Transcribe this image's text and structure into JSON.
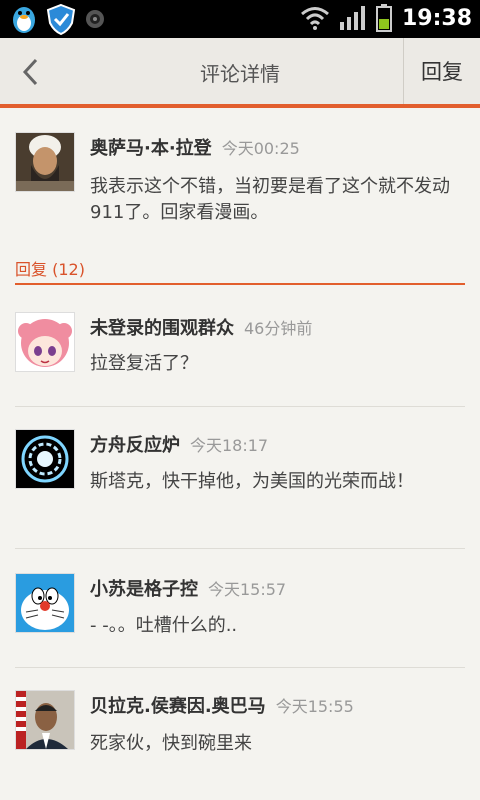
{
  "status_bar": {
    "time": "19:38"
  },
  "header": {
    "title": "评论详情",
    "reply_label": "回复"
  },
  "post": {
    "author": "奥萨马·本·拉登",
    "time": "今天00:25",
    "content": "我表示这个不错，当初要是看了这个就不发动911了。回家看漫画。"
  },
  "replies_header": "回复 (12)",
  "replies": [
    {
      "author": "未登录的围观群众",
      "time": "46分钟前",
      "content": "拉登复活了？"
    },
    {
      "author": "方舟反应炉",
      "time": "今天18:17",
      "content": "斯塔克，快干掉他，为美国的光荣而战！"
    },
    {
      "author": "小苏是格子控",
      "time": "今天15:57",
      "content": "- -。。吐槽什么的.."
    },
    {
      "author": "贝拉克.侯赛因.奥巴马",
      "time": "今天15:55",
      "content": "死家伙，快到碗里来"
    }
  ],
  "colors": {
    "accent": "#e25e2d",
    "background": "#f4f3ef"
  },
  "icons": [
    "qq-penguin-icon",
    "shield-icon",
    "camera-icon",
    "wifi-icon",
    "signal-icon",
    "battery-icon",
    "back-arrow-icon"
  ]
}
